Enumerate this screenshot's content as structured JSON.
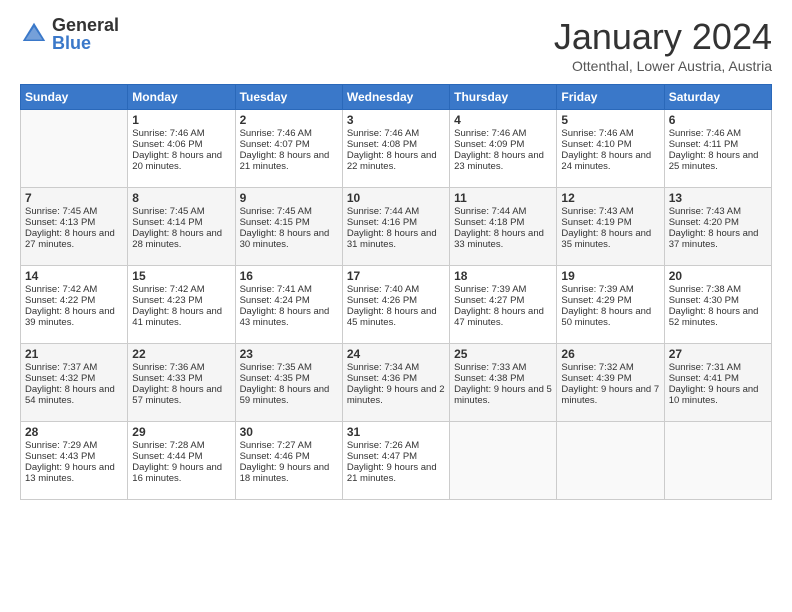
{
  "logo": {
    "general": "General",
    "blue": "Blue"
  },
  "header": {
    "month": "January 2024",
    "location": "Ottenthal, Lower Austria, Austria"
  },
  "weekdays": [
    "Sunday",
    "Monday",
    "Tuesday",
    "Wednesday",
    "Thursday",
    "Friday",
    "Saturday"
  ],
  "weeks": [
    [
      {
        "day": "",
        "sunrise": "",
        "sunset": "",
        "daylight": ""
      },
      {
        "day": "1",
        "sunrise": "Sunrise: 7:46 AM",
        "sunset": "Sunset: 4:06 PM",
        "daylight": "Daylight: 8 hours and 20 minutes."
      },
      {
        "day": "2",
        "sunrise": "Sunrise: 7:46 AM",
        "sunset": "Sunset: 4:07 PM",
        "daylight": "Daylight: 8 hours and 21 minutes."
      },
      {
        "day": "3",
        "sunrise": "Sunrise: 7:46 AM",
        "sunset": "Sunset: 4:08 PM",
        "daylight": "Daylight: 8 hours and 22 minutes."
      },
      {
        "day": "4",
        "sunrise": "Sunrise: 7:46 AM",
        "sunset": "Sunset: 4:09 PM",
        "daylight": "Daylight: 8 hours and 23 minutes."
      },
      {
        "day": "5",
        "sunrise": "Sunrise: 7:46 AM",
        "sunset": "Sunset: 4:10 PM",
        "daylight": "Daylight: 8 hours and 24 minutes."
      },
      {
        "day": "6",
        "sunrise": "Sunrise: 7:46 AM",
        "sunset": "Sunset: 4:11 PM",
        "daylight": "Daylight: 8 hours and 25 minutes."
      }
    ],
    [
      {
        "day": "7",
        "sunrise": "Sunrise: 7:45 AM",
        "sunset": "Sunset: 4:13 PM",
        "daylight": "Daylight: 8 hours and 27 minutes."
      },
      {
        "day": "8",
        "sunrise": "Sunrise: 7:45 AM",
        "sunset": "Sunset: 4:14 PM",
        "daylight": "Daylight: 8 hours and 28 minutes."
      },
      {
        "day": "9",
        "sunrise": "Sunrise: 7:45 AM",
        "sunset": "Sunset: 4:15 PM",
        "daylight": "Daylight: 8 hours and 30 minutes."
      },
      {
        "day": "10",
        "sunrise": "Sunrise: 7:44 AM",
        "sunset": "Sunset: 4:16 PM",
        "daylight": "Daylight: 8 hours and 31 minutes."
      },
      {
        "day": "11",
        "sunrise": "Sunrise: 7:44 AM",
        "sunset": "Sunset: 4:18 PM",
        "daylight": "Daylight: 8 hours and 33 minutes."
      },
      {
        "day": "12",
        "sunrise": "Sunrise: 7:43 AM",
        "sunset": "Sunset: 4:19 PM",
        "daylight": "Daylight: 8 hours and 35 minutes."
      },
      {
        "day": "13",
        "sunrise": "Sunrise: 7:43 AM",
        "sunset": "Sunset: 4:20 PM",
        "daylight": "Daylight: 8 hours and 37 minutes."
      }
    ],
    [
      {
        "day": "14",
        "sunrise": "Sunrise: 7:42 AM",
        "sunset": "Sunset: 4:22 PM",
        "daylight": "Daylight: 8 hours and 39 minutes."
      },
      {
        "day": "15",
        "sunrise": "Sunrise: 7:42 AM",
        "sunset": "Sunset: 4:23 PM",
        "daylight": "Daylight: 8 hours and 41 minutes."
      },
      {
        "day": "16",
        "sunrise": "Sunrise: 7:41 AM",
        "sunset": "Sunset: 4:24 PM",
        "daylight": "Daylight: 8 hours and 43 minutes."
      },
      {
        "day": "17",
        "sunrise": "Sunrise: 7:40 AM",
        "sunset": "Sunset: 4:26 PM",
        "daylight": "Daylight: 8 hours and 45 minutes."
      },
      {
        "day": "18",
        "sunrise": "Sunrise: 7:39 AM",
        "sunset": "Sunset: 4:27 PM",
        "daylight": "Daylight: 8 hours and 47 minutes."
      },
      {
        "day": "19",
        "sunrise": "Sunrise: 7:39 AM",
        "sunset": "Sunset: 4:29 PM",
        "daylight": "Daylight: 8 hours and 50 minutes."
      },
      {
        "day": "20",
        "sunrise": "Sunrise: 7:38 AM",
        "sunset": "Sunset: 4:30 PM",
        "daylight": "Daylight: 8 hours and 52 minutes."
      }
    ],
    [
      {
        "day": "21",
        "sunrise": "Sunrise: 7:37 AM",
        "sunset": "Sunset: 4:32 PM",
        "daylight": "Daylight: 8 hours and 54 minutes."
      },
      {
        "day": "22",
        "sunrise": "Sunrise: 7:36 AM",
        "sunset": "Sunset: 4:33 PM",
        "daylight": "Daylight: 8 hours and 57 minutes."
      },
      {
        "day": "23",
        "sunrise": "Sunrise: 7:35 AM",
        "sunset": "Sunset: 4:35 PM",
        "daylight": "Daylight: 8 hours and 59 minutes."
      },
      {
        "day": "24",
        "sunrise": "Sunrise: 7:34 AM",
        "sunset": "Sunset: 4:36 PM",
        "daylight": "Daylight: 9 hours and 2 minutes."
      },
      {
        "day": "25",
        "sunrise": "Sunrise: 7:33 AM",
        "sunset": "Sunset: 4:38 PM",
        "daylight": "Daylight: 9 hours and 5 minutes."
      },
      {
        "day": "26",
        "sunrise": "Sunrise: 7:32 AM",
        "sunset": "Sunset: 4:39 PM",
        "daylight": "Daylight: 9 hours and 7 minutes."
      },
      {
        "day": "27",
        "sunrise": "Sunrise: 7:31 AM",
        "sunset": "Sunset: 4:41 PM",
        "daylight": "Daylight: 9 hours and 10 minutes."
      }
    ],
    [
      {
        "day": "28",
        "sunrise": "Sunrise: 7:29 AM",
        "sunset": "Sunset: 4:43 PM",
        "daylight": "Daylight: 9 hours and 13 minutes."
      },
      {
        "day": "29",
        "sunrise": "Sunrise: 7:28 AM",
        "sunset": "Sunset: 4:44 PM",
        "daylight": "Daylight: 9 hours and 16 minutes."
      },
      {
        "day": "30",
        "sunrise": "Sunrise: 7:27 AM",
        "sunset": "Sunset: 4:46 PM",
        "daylight": "Daylight: 9 hours and 18 minutes."
      },
      {
        "day": "31",
        "sunrise": "Sunrise: 7:26 AM",
        "sunset": "Sunset: 4:47 PM",
        "daylight": "Daylight: 9 hours and 21 minutes."
      },
      {
        "day": "",
        "sunrise": "",
        "sunset": "",
        "daylight": ""
      },
      {
        "day": "",
        "sunrise": "",
        "sunset": "",
        "daylight": ""
      },
      {
        "day": "",
        "sunrise": "",
        "sunset": "",
        "daylight": ""
      }
    ]
  ]
}
